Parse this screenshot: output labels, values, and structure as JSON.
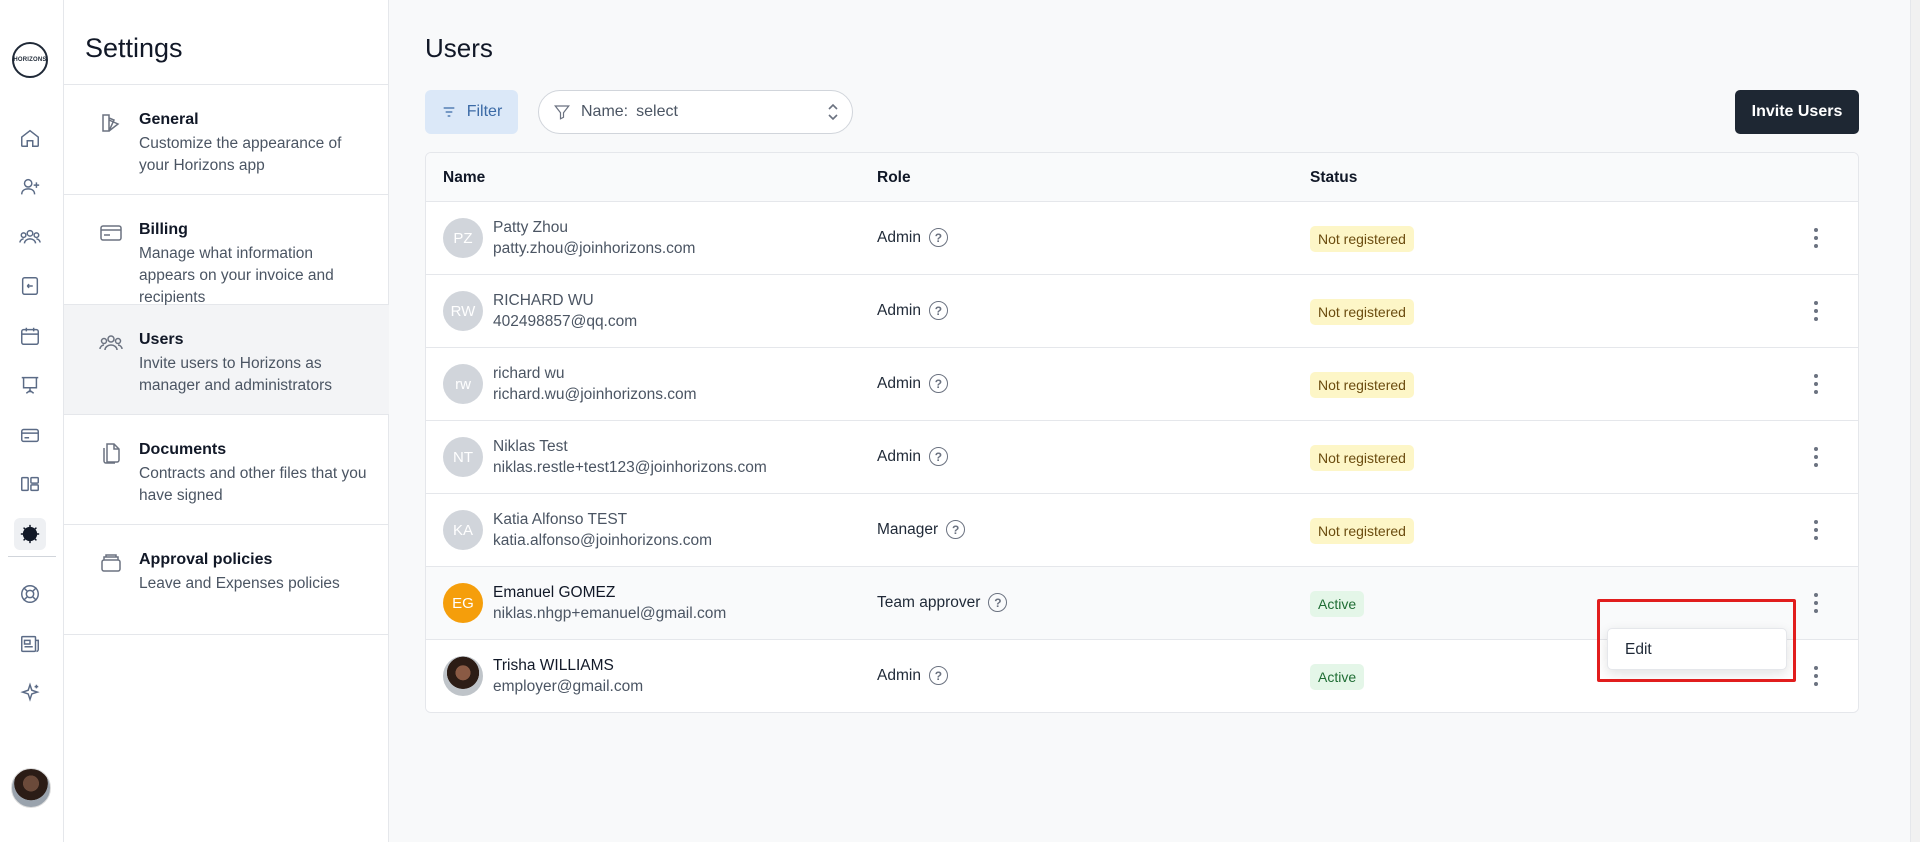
{
  "rail": {
    "logo_text": "HORIZONS",
    "icons": [
      "home-icon",
      "add-user-icon",
      "team-icon",
      "time-off-icon",
      "calendar-icon",
      "presentation-icon",
      "credit-card-icon",
      "layout-icon",
      "gear-icon",
      "support-icon",
      "news-icon",
      "sparkles-icon"
    ]
  },
  "settings": {
    "title": "Settings",
    "items": [
      {
        "title": "General",
        "desc": "Customize the appearance of your Horizons app"
      },
      {
        "title": "Billing",
        "desc": "Manage what information appears on your invoice and recipients"
      },
      {
        "title": "Users",
        "desc": "Invite users to Horizons as manager and administrators"
      },
      {
        "title": "Documents",
        "desc": "Contracts and other files that you have signed"
      },
      {
        "title": "Approval policies",
        "desc": "Leave and Expenses policies"
      }
    ]
  },
  "main": {
    "title": "Users",
    "filter_label": "Filter",
    "name_filter_label": "Name:",
    "name_filter_value": "select",
    "invite_label": "Invite Users"
  },
  "table": {
    "columns": [
      "Name",
      "Role",
      "Status"
    ],
    "rows": [
      {
        "initials": "PZ",
        "name": "Patty Zhou",
        "email": "patty.zhou@joinhorizons.com",
        "role": "Admin",
        "status": "Not registered"
      },
      {
        "initials": "RW",
        "name": "RICHARD WU",
        "email": "402498857@qq.com",
        "role": "Admin",
        "status": "Not registered"
      },
      {
        "initials": "rw",
        "name": "richard wu",
        "email": "richard.wu@joinhorizons.com",
        "role": "Admin",
        "status": "Not registered"
      },
      {
        "initials": "NT",
        "name": "Niklas Test",
        "email": "niklas.restle+test123@joinhorizons.com",
        "role": "Admin",
        "status": "Not registered"
      },
      {
        "initials": "KA",
        "name": "Katia Alfonso TEST",
        "email": "katia.alfonso@joinhorizons.com",
        "role": "Manager",
        "status": "Not registered"
      },
      {
        "initials": "EG",
        "name": "Emanuel GOMEZ",
        "email": "niklas.nhgp+emanuel@gmail.com",
        "role": "Team approver",
        "status": "Active"
      },
      {
        "initials": "",
        "name": "Trisha WILLIAMS",
        "email": "employer@gmail.com",
        "role": "Admin",
        "status": "Active"
      }
    ]
  },
  "context_menu": {
    "edit_label": "Edit"
  },
  "help_glyph": "?",
  "colors": {
    "accent": "#1e2733",
    "filter_bg": "#dbe8f8",
    "badge_warn": "#fdf6c7",
    "badge_ok": "#e4f6e8",
    "highlight": "#e11d1d",
    "orange_avatar": "#f59e0b"
  }
}
